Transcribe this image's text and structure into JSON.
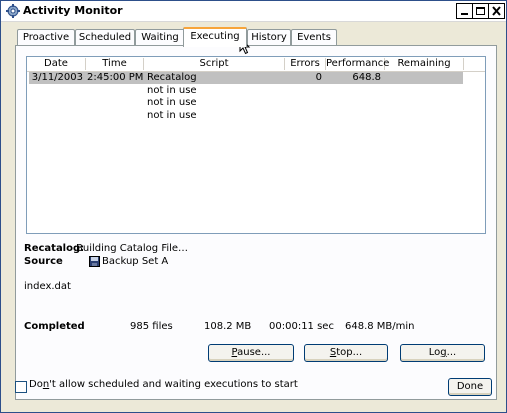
{
  "window": {
    "title": "Activity Monitor"
  },
  "tabs": [
    {
      "label": "Proactive",
      "active": false
    },
    {
      "label": "Scheduled",
      "active": false
    },
    {
      "label": "Waiting",
      "active": false
    },
    {
      "label": "Executing",
      "active": true
    },
    {
      "label": "History",
      "active": false
    },
    {
      "label": "Events",
      "active": false
    }
  ],
  "table": {
    "columns": [
      "Date",
      "Time",
      "Script",
      "Errors",
      "Performance",
      "Remaining"
    ],
    "rows": [
      {
        "date": "3/11/2003",
        "time": "2:45:00 PM",
        "script": "Recatalog",
        "errors": "0",
        "performance": "648.8",
        "remaining": "",
        "selected": true
      },
      {
        "date": "",
        "time": "",
        "script": "not in use",
        "errors": "",
        "performance": "",
        "remaining": "",
        "selected": false
      },
      {
        "date": "",
        "time": "",
        "script": "not in use",
        "errors": "",
        "performance": "",
        "remaining": "",
        "selected": false
      },
      {
        "date": "",
        "time": "",
        "script": "not in use",
        "errors": "",
        "performance": "",
        "remaining": "",
        "selected": false
      }
    ]
  },
  "status": {
    "activity_label": "Recatalog:",
    "activity_text": "Building Catalog File…",
    "source_label": "Source",
    "source_value": "Backup Set A",
    "current_file": "index.dat"
  },
  "completed": {
    "label": "Completed",
    "files": "985 files",
    "size": "108.2 MB",
    "time": "00:00:11 sec",
    "rate": "648.8 MB/min"
  },
  "buttons": {
    "pause_mnemonic": "P",
    "pause_rest": "ause...",
    "stop_mnemonic": "S",
    "stop_rest": "top...",
    "log_pre": "Lo",
    "log_mnemonic": "g",
    "log_rest": "...",
    "done": "Done"
  },
  "footer": {
    "checkbox_pre": "Do",
    "checkbox_mnemonic": "n",
    "checkbox_rest": "'t allow scheduled and waiting executions to start",
    "checkbox_checked": false
  }
}
